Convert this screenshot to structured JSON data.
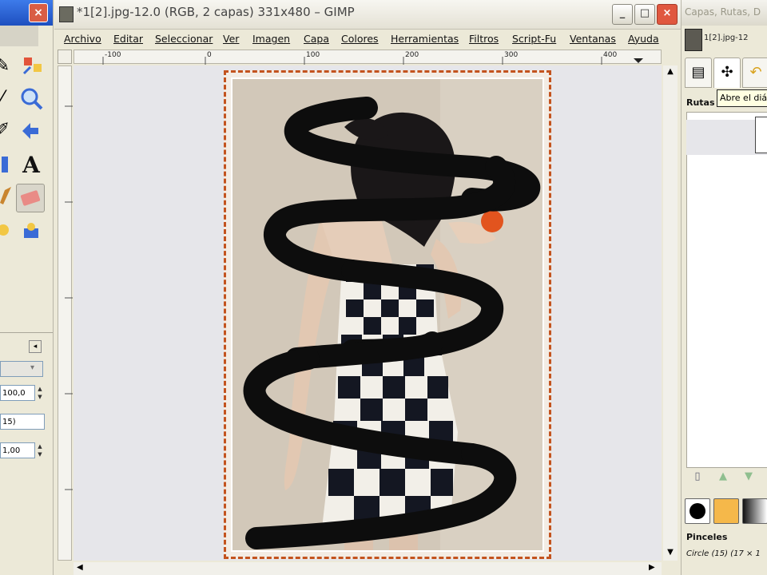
{
  "toolbox": {
    "close_glyph": "×",
    "options": {
      "opacity_value": "100,0",
      "brush_value": "15)",
      "scale_value": "1,00"
    }
  },
  "image_window": {
    "title": "*1[2].jpg-12.0 (RGB, 2 capas) 331x480 – GIMP",
    "menu": [
      "Archivo",
      "Editar",
      "Seleccionar",
      "Ver",
      "Imagen",
      "Capa",
      "Colores",
      "Herramientas",
      "Filtros",
      "Script-Fu",
      "Ventanas",
      "Ayuda"
    ],
    "ruler_labels": [
      "-100",
      "0",
      "100",
      "200",
      "300",
      "400"
    ],
    "window_buttons": {
      "minimize": "_",
      "maximize": "□",
      "close": "×"
    }
  },
  "dock": {
    "title": "Capas, Rutas, D",
    "image_name": "1[2].jpg-12",
    "tooltip": "Abre el diá",
    "paths_label": "Rutas",
    "brushes_label": "Pinceles",
    "brush_name": "Circle (15) (17 × 1",
    "colors": {
      "fg": "#000000",
      "bg": "#f5b84a"
    }
  },
  "icons": {
    "layers_tab": "layers-icon",
    "paths_tab": "paths-icon",
    "undo_tab": "undo-icon",
    "text_tool": "A"
  }
}
